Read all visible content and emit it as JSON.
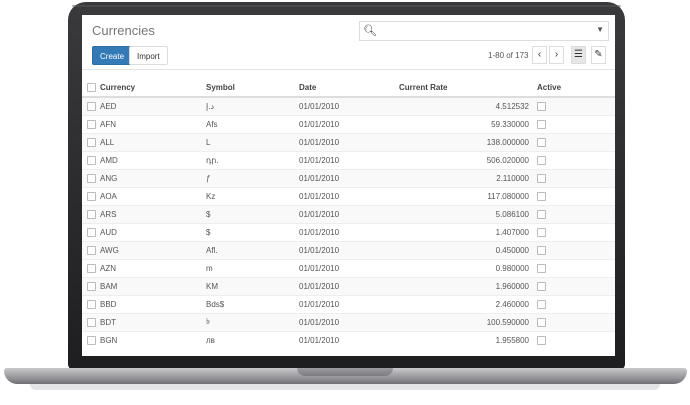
{
  "app": {
    "title": "Currencies",
    "create_label": "Create",
    "import_label": "Import",
    "pager_text": "1-80 of 173"
  },
  "icons": {
    "search": "search-icon",
    "dropdown": "caret-down-icon",
    "prev": "chevron-left-icon",
    "next": "chevron-right-icon",
    "list": "list-view-icon",
    "edit": "edit-icon"
  },
  "colors": {
    "primary": "#337ab7"
  },
  "table": {
    "columns": [
      "Currency",
      "Symbol",
      "Date",
      "Current Rate",
      "Active"
    ],
    "rows": [
      {
        "currency": "AED",
        "symbol": "د.إ",
        "date": "01/01/2010",
        "rate": "4.512532"
      },
      {
        "currency": "AFN",
        "symbol": "Afs",
        "date": "01/01/2010",
        "rate": "59.330000"
      },
      {
        "currency": "ALL",
        "symbol": "L",
        "date": "01/01/2010",
        "rate": "138.000000"
      },
      {
        "currency": "AMD",
        "symbol": "դր.",
        "date": "01/01/2010",
        "rate": "506.020000"
      },
      {
        "currency": "ANG",
        "symbol": "ƒ",
        "date": "01/01/2010",
        "rate": "2.110000"
      },
      {
        "currency": "AOA",
        "symbol": "Kz",
        "date": "01/01/2010",
        "rate": "117.080000"
      },
      {
        "currency": "ARS",
        "symbol": "$",
        "date": "01/01/2010",
        "rate": "5.086100"
      },
      {
        "currency": "AUD",
        "symbol": "$",
        "date": "01/01/2010",
        "rate": "1.407000"
      },
      {
        "currency": "AWG",
        "symbol": "Afl.",
        "date": "01/01/2010",
        "rate": "0.450000"
      },
      {
        "currency": "AZN",
        "symbol": "m",
        "date": "01/01/2010",
        "rate": "0.980000"
      },
      {
        "currency": "BAM",
        "symbol": "KM",
        "date": "01/01/2010",
        "rate": "1.960000"
      },
      {
        "currency": "BBD",
        "symbol": "Bds$",
        "date": "01/01/2010",
        "rate": "2.460000"
      },
      {
        "currency": "BDT",
        "symbol": "৳",
        "date": "01/01/2010",
        "rate": "100.590000"
      },
      {
        "currency": "BGN",
        "symbol": "лв",
        "date": "01/01/2010",
        "rate": "1.955800"
      }
    ]
  }
}
